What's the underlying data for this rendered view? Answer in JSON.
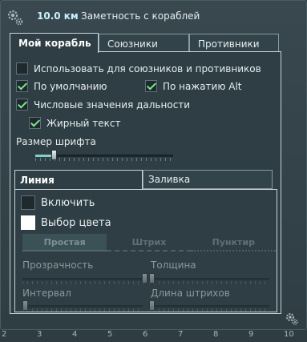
{
  "header": {
    "distance": "10.0 км",
    "title": "Заметность с кораблей",
    "gear_icon": "gear-icon"
  },
  "tabs": [
    {
      "label": "Мой корабль",
      "active": true
    },
    {
      "label": "Союзники",
      "active": false
    },
    {
      "label": "Противники",
      "active": false
    }
  ],
  "options": {
    "use_for_all": {
      "label": "Использовать для союзников и противников",
      "checked": false
    },
    "by_default": {
      "label": "По умолчанию",
      "checked": true
    },
    "on_alt": {
      "label": "По нажатию Alt",
      "checked": true
    },
    "range_numbers": {
      "label": "Числовые значения дальности",
      "checked": true
    },
    "bold_text": {
      "label": "Жирный текст",
      "checked": true
    }
  },
  "font_size": {
    "label": "Размер шрифта",
    "value": 0.12
  },
  "subtabs": [
    {
      "label": "Линия",
      "active": true
    },
    {
      "label": "Заливка",
      "active": false
    }
  ],
  "line": {
    "enable": {
      "label": "Включить",
      "checked": false
    },
    "color": {
      "label": "Выбор цвета",
      "color": "#ffffff"
    },
    "styles": [
      {
        "label": "Простая",
        "active": true
      },
      {
        "label": "Штрих",
        "active": false
      },
      {
        "label": "Пунктир",
        "active": false
      }
    ],
    "opacity": {
      "label": "Прозрачность",
      "value": 1.0
    },
    "thickness": {
      "label": "Толщина",
      "value": 0.0
    },
    "interval": {
      "label": "Интервал",
      "value": 0.0
    },
    "dash_length": {
      "label": "Длина штрихов",
      "value": 0.0
    }
  },
  "scale": [
    "2",
    "3",
    "4",
    "5",
    "6",
    "7",
    "8",
    "9",
    "10"
  ],
  "colors": {
    "accent": "#7fe88a",
    "highlight": "#c8f0ff"
  }
}
